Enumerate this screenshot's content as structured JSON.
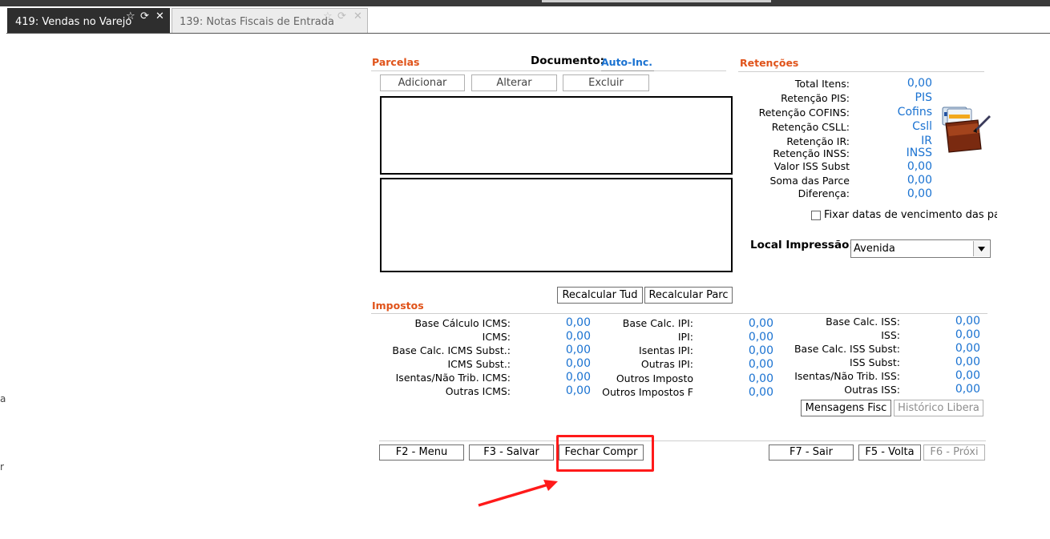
{
  "tabs": [
    {
      "label": "419: Vendas no Varejo",
      "active": true
    },
    {
      "label": "139: Notas Fiscais de Entrada",
      "active": false
    }
  ],
  "left_fragments": [
    "a",
    "r"
  ],
  "parcelas": {
    "title": "Parcelas",
    "documento_label": "Documento:",
    "documento_value": "Auto-Inc.",
    "buttons": {
      "adicionar": "Adicionar",
      "alterar": "Alterar",
      "excluir": "Excluir"
    }
  },
  "retencoes": {
    "title": "Retenções",
    "rows": [
      {
        "label": "Total Itens:",
        "value": "0,00"
      },
      {
        "label": "Retenção PIS:",
        "value": "PIS"
      },
      {
        "label": "Retenção COFINS:",
        "value": "Cofins"
      },
      {
        "label": "Retenção CSLL:",
        "value": "Csll"
      },
      {
        "label": "Retenção IR:",
        "value": "IR"
      },
      {
        "label": "Retenção INSS:",
        "value": "INSS"
      },
      {
        "label": "Valor ISS Subst",
        "value": "0,00"
      },
      {
        "label": "Soma das Parce",
        "value": "0,00"
      },
      {
        "label": "Diferença:",
        "value": "0,00"
      }
    ],
    "checkbox_label": "Fixar datas de vencimento das parc",
    "local_impressao_label": "Local Impressão:",
    "local_impressao_value": "Avenida"
  },
  "impostos": {
    "title": "Impostos",
    "recalc_tudo": "Recalcular Tud",
    "recalc_parc": "Recalcular Parc",
    "col1": [
      {
        "label": "Base Cálculo ICMS:",
        "value": "0,00"
      },
      {
        "label": "ICMS:",
        "value": "0,00"
      },
      {
        "label": "Base Calc. ICMS Subst.:",
        "value": "0,00"
      },
      {
        "label": "ICMS Subst.:",
        "value": "0,00"
      },
      {
        "label": "Isentas/Não Trib. ICMS:",
        "value": "0,00"
      },
      {
        "label": "Outras ICMS:",
        "value": "0,00"
      }
    ],
    "col2": [
      {
        "label": "Base Calc. IPI:",
        "value": "0,00"
      },
      {
        "label": "IPI:",
        "value": "0,00"
      },
      {
        "label": "Isentas IPI:",
        "value": "0,00"
      },
      {
        "label": "Outras IPI:",
        "value": "0,00"
      },
      {
        "label": "Outros Imposto",
        "value": "0,00"
      },
      {
        "label": "Outros Impostos F",
        "value": "0,00"
      }
    ],
    "col3": [
      {
        "label": "Base Calc. ISS:",
        "value": "0,00"
      },
      {
        "label": "ISS:",
        "value": "0,00"
      },
      {
        "label": "Base Calc. ISS Subst:",
        "value": "0,00"
      },
      {
        "label": "ISS Subst:",
        "value": "0,00"
      },
      {
        "label": "Isentas/Não Trib. ISS:",
        "value": "0,00"
      },
      {
        "label": "Outras ISS:",
        "value": "0,00"
      }
    ],
    "mensagens": "Mensagens Fisc",
    "historico": "Histórico Libera"
  },
  "footer": {
    "f2": "F2 - Menu",
    "f3": "F3 - Salvar",
    "fechar": "Fechar Compr",
    "f7": "F7 - Sair",
    "f5": "F5 - Volta",
    "f6": "F6 - Próxi"
  },
  "colors": {
    "accent": "#e0531a",
    "value_blue": "#1a72d1",
    "highlight_red": "#ff1a1a"
  }
}
